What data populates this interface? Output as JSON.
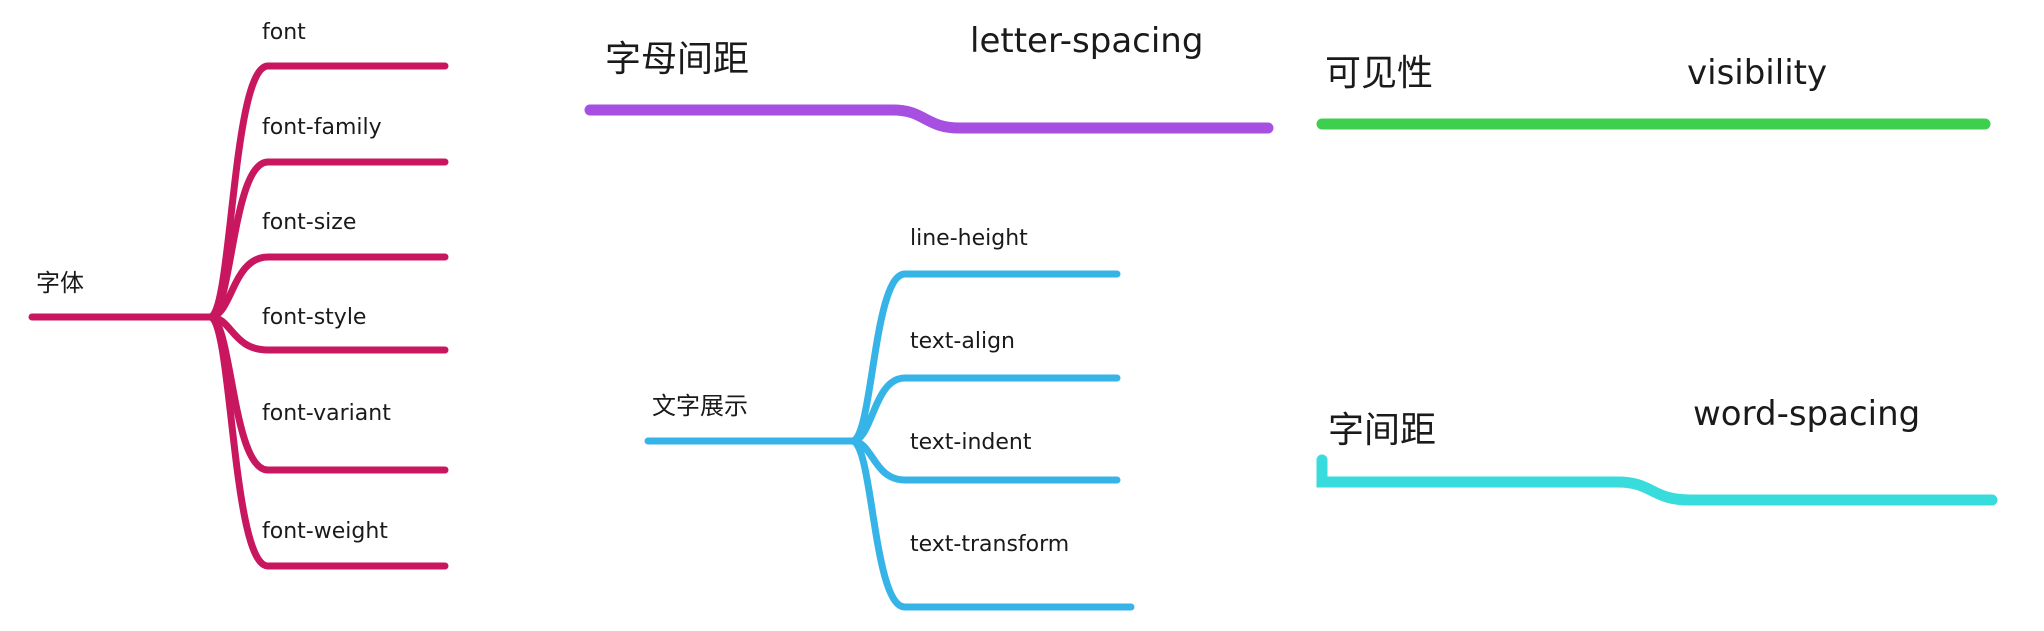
{
  "colors": {
    "font_branch": "#c8175f",
    "letter_spacing_branch": "#a64fe0",
    "visibility_branch": "#3ecf4e",
    "text_display_branch": "#36b4e8",
    "word_spacing_branch": "#38dcdc",
    "text": "#1a1a1a"
  },
  "font_tree": {
    "root": "字体",
    "children": [
      "font",
      "font-family",
      "font-size",
      "font-style",
      "font-variant",
      "font-weight"
    ]
  },
  "letter_spacing": {
    "zh": "字母间距",
    "en": "letter-spacing"
  },
  "visibility": {
    "zh": "可见性",
    "en": "visibility"
  },
  "text_display_tree": {
    "root": "文字展示",
    "children": [
      "line-height",
      "text-align",
      "text-indent",
      "text-transform"
    ]
  },
  "word_spacing": {
    "zh": "字间距",
    "en": "word-spacing"
  }
}
